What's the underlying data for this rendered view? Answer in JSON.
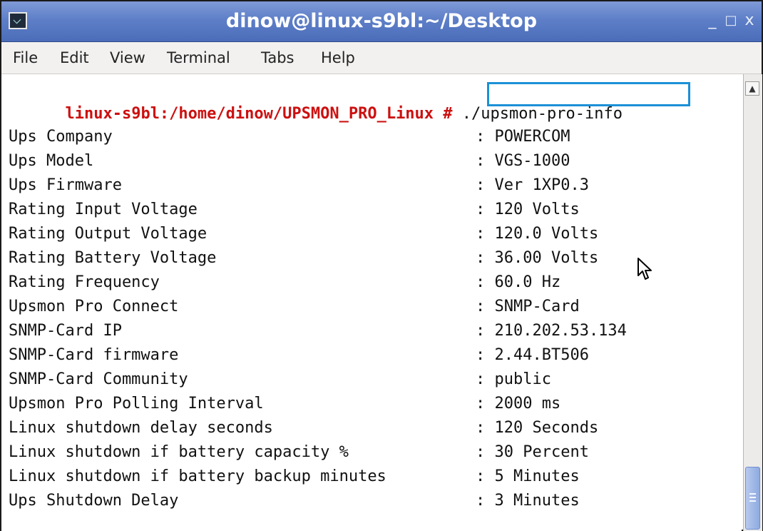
{
  "window": {
    "title": "dinow@linux-s9bl:~/Desktop",
    "controls": {
      "minimize": "_",
      "maximize": "□",
      "close": "x"
    }
  },
  "menu": [
    "File",
    "Edit",
    "View",
    "Terminal",
    "Tabs",
    "Help"
  ],
  "terminal": {
    "prompt": "linux-s9bl:/home/dinow/UPSMON_PRO_Linux #",
    "command": "./upsmon-pro-info",
    "rows": [
      {
        "label": "Ups Company",
        "value": ": POWERCOM"
      },
      {
        "label": "Ups Model",
        "value": ": VGS-1000"
      },
      {
        "label": "Ups Firmware",
        "value": ": Ver 1XP0.3"
      },
      {
        "label": "Rating Input Voltage",
        "value": ": 120 Volts"
      },
      {
        "label": "Rating Output Voltage",
        "value": ": 120.0 Volts"
      },
      {
        "label": "Rating Battery Voltage",
        "value": ": 36.00 Volts"
      },
      {
        "label": "Rating Frequency",
        "value": ": 60.0 Hz"
      },
      {
        "label": "Upsmon Pro Connect",
        "value": ": SNMP-Card"
      },
      {
        "label": "SNMP-Card IP",
        "value": ": 210.202.53.134"
      },
      {
        "label": "SNMP-Card firmware",
        "value": ": 2.44.BT506"
      },
      {
        "label": "SNMP-Card Community",
        "value": ": public"
      },
      {
        "label": "Upsmon Pro Polling Interval",
        "value": ": 2000 ms"
      },
      {
        "label": "Linux shutdown delay seconds",
        "value": ": 120 Seconds"
      },
      {
        "label": "Linux shutdown if battery capacity %",
        "value": ": 30 Percent"
      },
      {
        "label": "Linux shutdown if battery backup minutes",
        "value": ": 5 Minutes"
      },
      {
        "label": "Ups Shutdown Delay",
        "value": ": 3 Minutes"
      }
    ]
  },
  "colors": {
    "titlebar": "#5e7fc8",
    "prompt": "#cc1010",
    "command_highlight": "#1b90d6"
  },
  "icons": {
    "app": "terminal-icon",
    "scroll_up": "arrow-up-icon",
    "pointer": "mouse-pointer-icon"
  }
}
